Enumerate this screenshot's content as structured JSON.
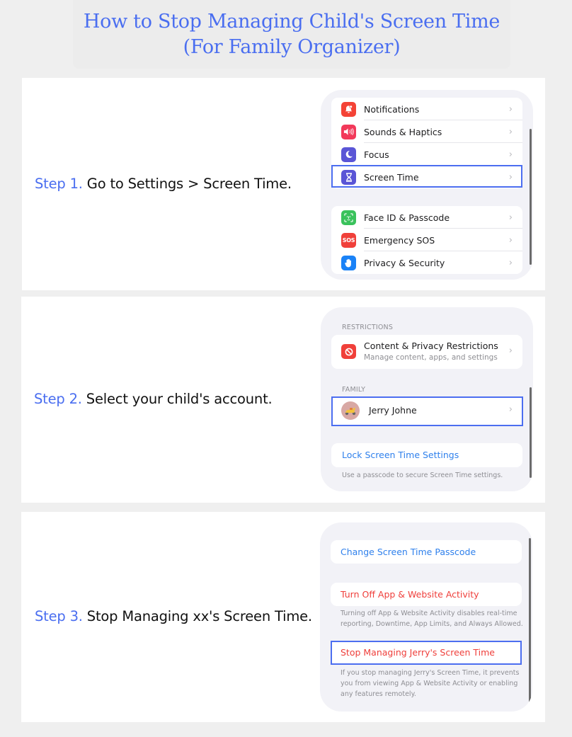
{
  "title": {
    "line1": "How to Stop Managing Child's Screen Time",
    "line2": "(For Family Organizer)"
  },
  "accent_color": "#4a6ef0",
  "steps": [
    {
      "num": "Step 1.",
      "text": " Go to Settings > Screen Time.",
      "settings_list": {
        "group1": [
          {
            "label": "Notifications",
            "icon": "bell-icon",
            "color": "#f44336"
          },
          {
            "label": "Sounds & Haptics",
            "icon": "speaker-icon",
            "color": "#f2395a"
          },
          {
            "label": "Focus",
            "icon": "moon-icon",
            "color": "#5a55d6"
          },
          {
            "label": "Screen Time",
            "icon": "hourglass-icon",
            "color": "#5a55d6",
            "highlighted": true
          }
        ],
        "group2": [
          {
            "label": "Face ID & Passcode",
            "icon": "face-id-icon",
            "color": "#3ac25c"
          },
          {
            "label": "Emergency SOS",
            "icon": "sos-icon",
            "color": "#f0403a",
            "icon_text": "SOS"
          },
          {
            "label": "Privacy & Security",
            "icon": "hand-icon",
            "color": "#1a82f7"
          }
        ]
      }
    },
    {
      "num": "Step 2.",
      "text": " Select your child's account.",
      "screen": {
        "restrictions_caption": "RESTRICTIONS",
        "restrictions_title": "Content & Privacy Restrictions",
        "restrictions_subtitle": "Manage content, apps, and settings",
        "family_caption": "FAMILY",
        "family_member": "Jerry Johne",
        "lock_link": "Lock Screen Time Settings",
        "lock_footnote": "Use a passcode to secure Screen Time settings."
      }
    },
    {
      "num": "Step 3.",
      "text": " Stop Managing xx's Screen Time.",
      "screen": {
        "change_passcode": "Change Screen Time Passcode",
        "turn_off": "Turn Off App & Website Activity",
        "turn_off_footnote": "Turning off App & Website Activity disables real-time reporting, Downtime, App Limits, and Always Allowed.",
        "stop_managing": "Stop Managing Jerry's Screen Time",
        "stop_footnote": "If you stop managing Jerry's Screen Time, it prevents you from viewing App & Website Activity or enabling any features remotely."
      }
    }
  ],
  "chevron": "›"
}
